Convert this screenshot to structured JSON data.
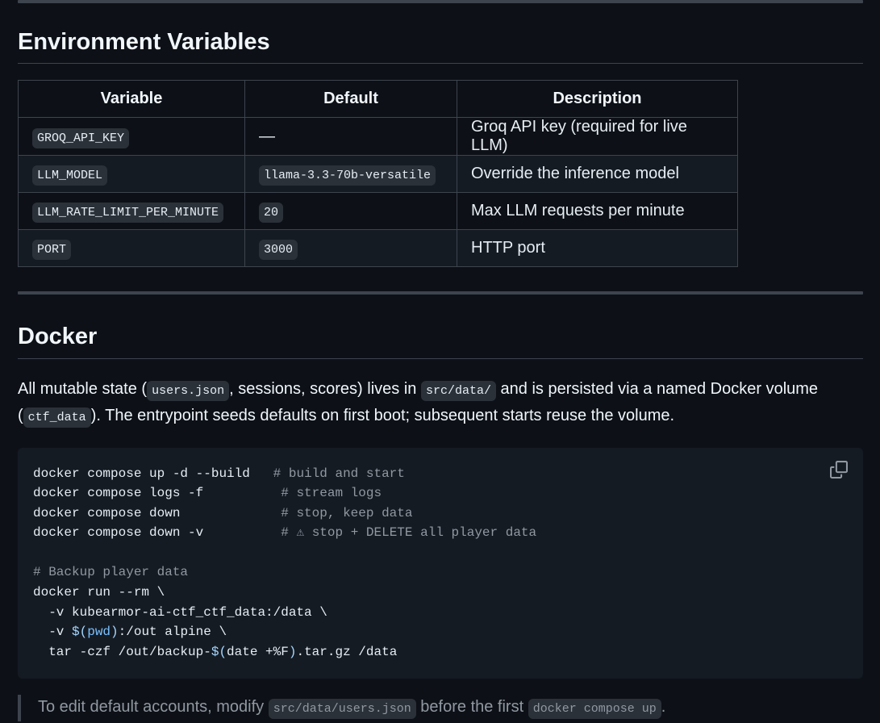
{
  "env_section": {
    "heading": "Environment Variables",
    "table": {
      "headers": [
        "Variable",
        "Default",
        "Description"
      ],
      "rows": [
        {
          "variable": "GROQ_API_KEY",
          "default": "—",
          "default_is_code": false,
          "description": "Groq API key (required for live LLM)"
        },
        {
          "variable": "LLM_MODEL",
          "default": "llama-3.3-70b-versatile",
          "default_is_code": true,
          "description": "Override the inference model"
        },
        {
          "variable": "LLM_RATE_LIMIT_PER_MINUTE",
          "default": "20",
          "default_is_code": true,
          "description": "Max LLM requests per minute"
        },
        {
          "variable": "PORT",
          "default": "3000",
          "default_is_code": true,
          "description": "HTTP port"
        }
      ]
    }
  },
  "docker_section": {
    "heading": "Docker",
    "paragraph": {
      "t1": "All mutable state (",
      "c1": "users.json",
      "t2": ", sessions, scores) lives in ",
      "c2": "src/data/",
      "t3": " and is persisted via a named Docker volume (",
      "c3": "ctf_data",
      "t4": "). The entrypoint seeds defaults on first boot; subsequent starts reuse the volume."
    },
    "code_block": {
      "copy_label": "Copy",
      "lines": [
        [
          {
            "t": "docker compose up -d --build   ",
            "k": ""
          },
          {
            "t": "# build and start",
            "k": "comment"
          }
        ],
        [
          {
            "t": "docker compose logs -f          ",
            "k": ""
          },
          {
            "t": "# stream logs",
            "k": "comment"
          }
        ],
        [
          {
            "t": "docker compose down             ",
            "k": ""
          },
          {
            "t": "# stop, keep data",
            "k": "comment"
          }
        ],
        [
          {
            "t": "docker compose down -v          ",
            "k": ""
          },
          {
            "t": "# ⚠ stop + DELETE all player data",
            "k": "comment"
          }
        ],
        [
          {
            "t": "",
            "k": ""
          }
        ],
        [
          {
            "t": "# Backup player data",
            "k": "comment"
          }
        ],
        [
          {
            "t": "docker run --rm \\",
            "k": ""
          }
        ],
        [
          {
            "t": "  -v kubearmor-ai-ctf_ctf_data:/data \\",
            "k": ""
          }
        ],
        [
          {
            "t": "  -v ",
            "k": ""
          },
          {
            "t": "$(",
            "k": "subst"
          },
          {
            "t": "pwd",
            "k": "var"
          },
          {
            "t": ")",
            "k": "subst"
          },
          {
            "t": ":/out alpine \\",
            "k": ""
          }
        ],
        [
          {
            "t": "  tar -czf /out/backup-",
            "k": ""
          },
          {
            "t": "$(",
            "k": "subst"
          },
          {
            "t": "date +%F",
            "k": ""
          },
          {
            "t": ")",
            "k": "subst"
          },
          {
            "t": ".tar.gz /data",
            "k": ""
          }
        ]
      ]
    },
    "note": {
      "t1": "To edit default accounts, modify ",
      "c1": "src/data/users.json",
      "t2": " before the first ",
      "c2": "docker compose up",
      "t3": "."
    }
  }
}
